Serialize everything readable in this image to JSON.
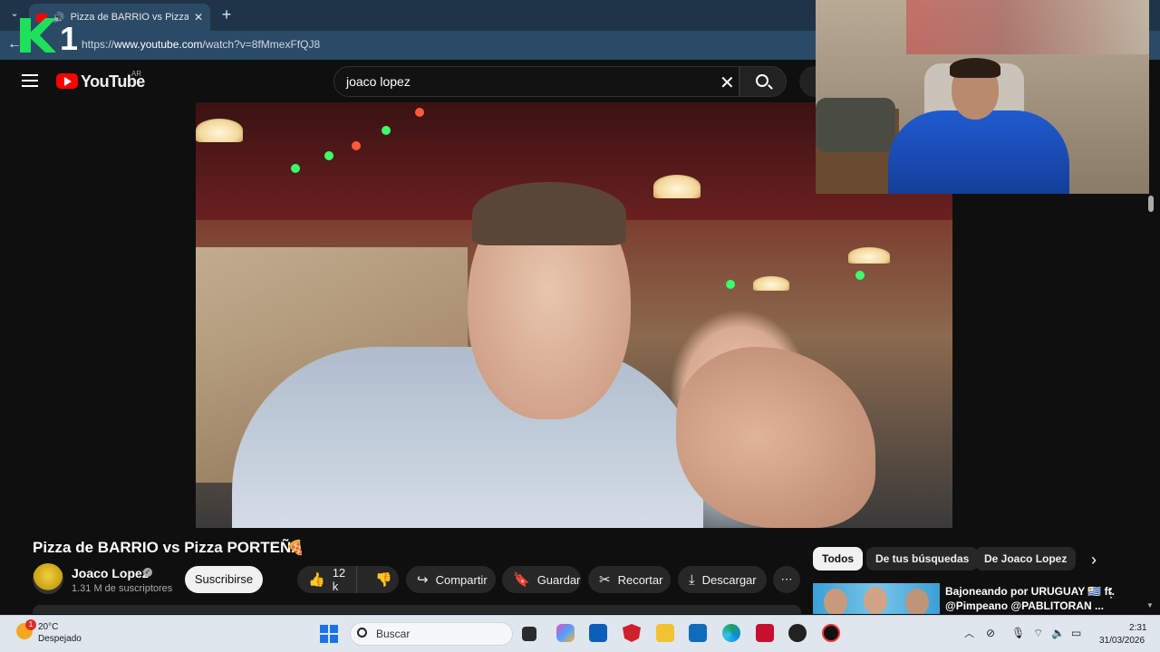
{
  "browser": {
    "tab_title": "Pizza de BARRIO vs Pizza PORTEÑA",
    "url_prefix": "https://",
    "url_host": "www.youtube.com",
    "url_path": "/watch?v=8fMmexFfQJ8"
  },
  "overlay_logo": {
    "text": "1"
  },
  "youtube": {
    "logo_text": "YouTube",
    "country_code": "AR",
    "search_query": "joaco lopez"
  },
  "video": {
    "title": "Pizza de BARRIO vs Pizza PORTEÑA",
    "channel": "Joaco Lopez",
    "subscribers": "1.31 M de suscriptores",
    "subscribe_label": "Suscribirse",
    "likes": "12 k",
    "share_label": "Compartir",
    "save_label": "Guardar",
    "clip_label": "Recortar",
    "download_label": "Descargar"
  },
  "filter_chips": [
    "Todos",
    "De tus búsquedas",
    "De Joaco Lopez"
  ],
  "recommendation": {
    "title_line1": "Bajoneando por URUGUAY 🇺🇾 ft.",
    "title_line2": "@Pimpeano @PABLITORAN ..."
  },
  "taskbar": {
    "weather_badge": "1",
    "temperature": "20°C",
    "weather": "Despejado",
    "search_placeholder": "Buscar",
    "time": "2:31",
    "date": "31/03/2026"
  },
  "colors": {
    "yt_red": "#ff0000",
    "page_bg": "#0f0f0f",
    "browser_chrome": "#2b4a66",
    "logo_green": "#1ee05a"
  }
}
